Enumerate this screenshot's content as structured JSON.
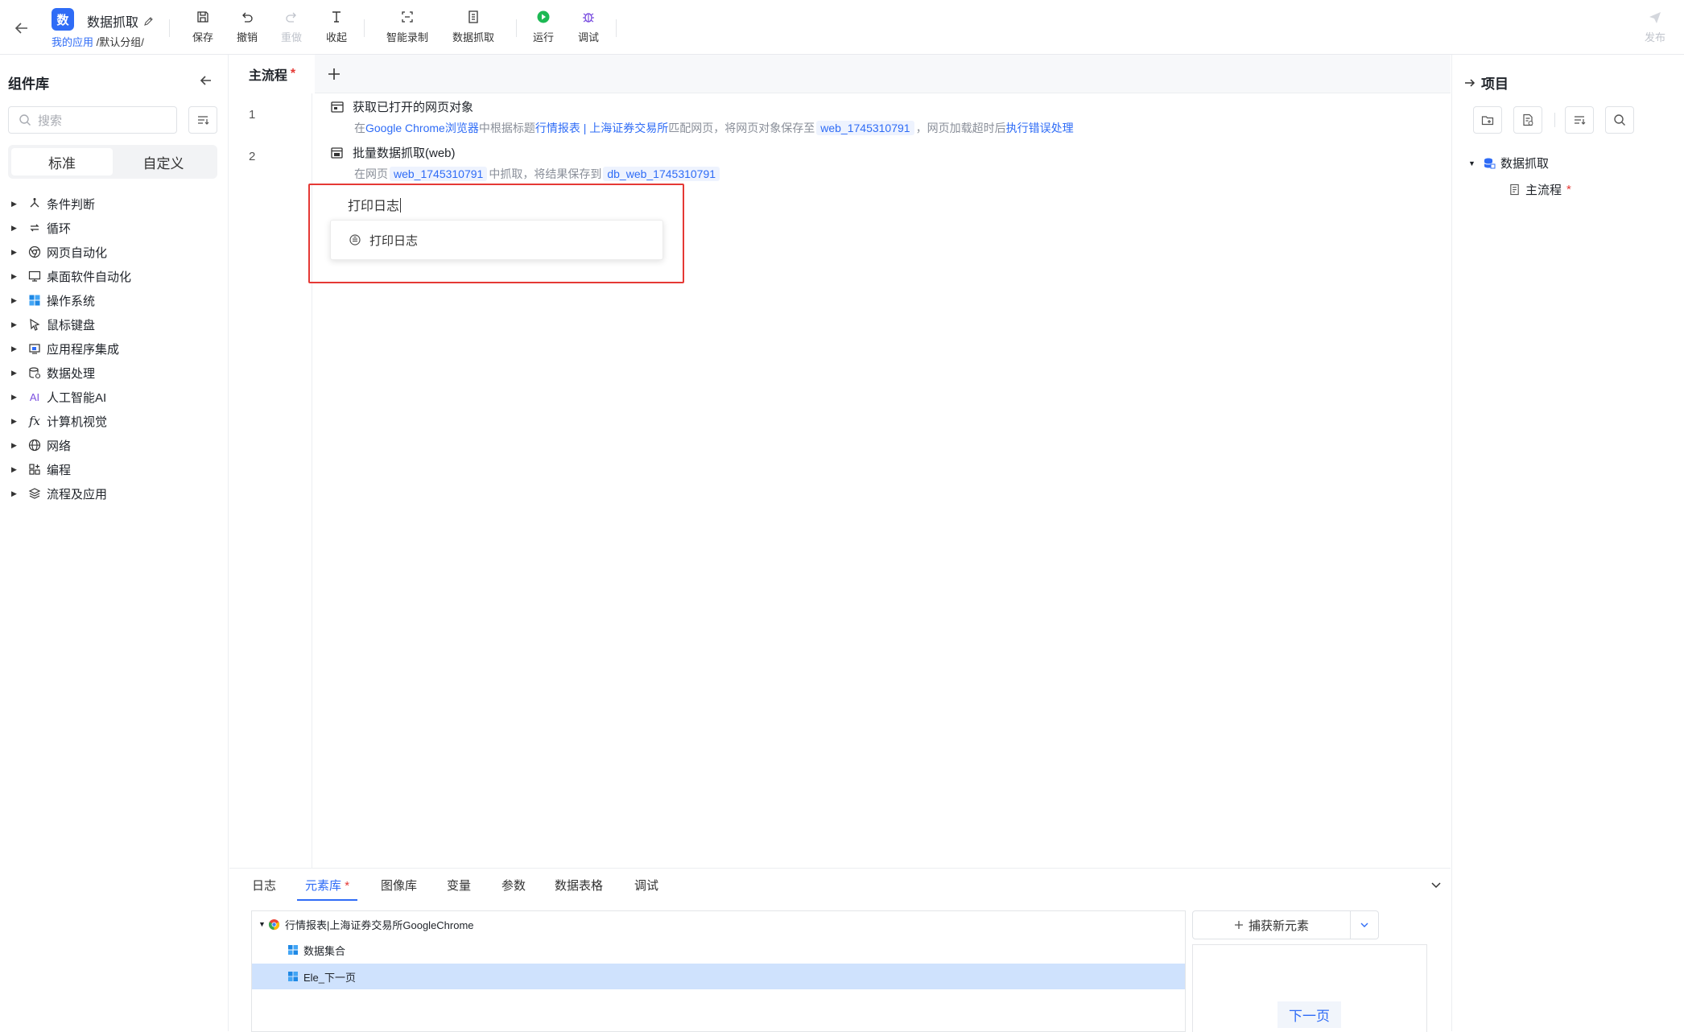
{
  "app": {
    "badge": "数",
    "title": "数据抓取",
    "breadcrumb_link": "我的应用",
    "breadcrumb_rest": " /默认分组/"
  },
  "toolbar": {
    "save": "保存",
    "undo": "撤销",
    "redo": "重做",
    "collapse": "收起",
    "smart_record": "智能录制",
    "data_capture": "数据抓取",
    "run": "运行",
    "debug": "调试",
    "publish": "发布"
  },
  "left_panel": {
    "title": "组件库",
    "search_placeholder": "搜索",
    "tab_standard": "标准",
    "tab_custom": "自定义",
    "categories": [
      {
        "label": "条件判断",
        "icon": "branch-icon"
      },
      {
        "label": "循环",
        "icon": "loop-icon"
      },
      {
        "label": "网页自动化",
        "icon": "browser-icon"
      },
      {
        "label": "桌面软件自动化",
        "icon": "desktop-icon"
      },
      {
        "label": "操作系统",
        "icon": "windows-icon"
      },
      {
        "label": "鼠标键盘",
        "icon": "cursor-icon"
      },
      {
        "label": "应用程序集成",
        "icon": "app-integration-icon"
      },
      {
        "label": "数据处理",
        "icon": "data-icon"
      },
      {
        "label": "人工智能AI",
        "icon": "ai-icon"
      },
      {
        "label": "计算机视觉",
        "icon": "fx-icon"
      },
      {
        "label": "网络",
        "icon": "globe-icon"
      },
      {
        "label": "编程",
        "icon": "code-icon"
      },
      {
        "label": "流程及应用",
        "icon": "layers-icon"
      }
    ]
  },
  "editor": {
    "tab_main": "主流程",
    "tab_modified_mark": "*",
    "line_numbers": [
      "1",
      "2"
    ],
    "step1": {
      "title": "获取已打开的网页对象",
      "d1": "在",
      "d2": "Google Chrome浏览器",
      "d3": "中根据标题",
      "d4": "行情报表 | 上海证券交易所",
      "d5": "匹配网页，将网页对象保存至",
      "d6": "web_1745310791",
      "d7": "，网页加载超时后",
      "d8": "执行错误处理"
    },
    "step2": {
      "title": "批量数据抓取(web)",
      "d1": "在网页",
      "d2": "web_1745310791",
      "d3": "中抓取，将结果保存到",
      "d4": "db_web_1745310791"
    },
    "typed_text": "打印日志",
    "suggestion": "打印日志"
  },
  "bottom_panel": {
    "tabs": [
      "日志",
      "元素库",
      "图像库",
      "变量",
      "参数",
      "数据表格",
      "调试"
    ],
    "active_tab_mark": "*",
    "element_tree": {
      "root": "行情报表|上海证券交易所GoogleChrome",
      "children": [
        "数据集合",
        "Ele_下一页"
      ]
    },
    "capture_button": "捕获新元素",
    "preview_label": "下一页"
  },
  "right_panel": {
    "title": "项目",
    "project_name": "数据抓取",
    "flow_name": "主流程",
    "flow_mark": "*"
  },
  "colors": {
    "accent": "#2f6cf6",
    "highlight_box": "#e53935",
    "selected_row": "#cfe2fd",
    "run_green": "#1db954",
    "debug_purple": "#7b4fe0"
  }
}
